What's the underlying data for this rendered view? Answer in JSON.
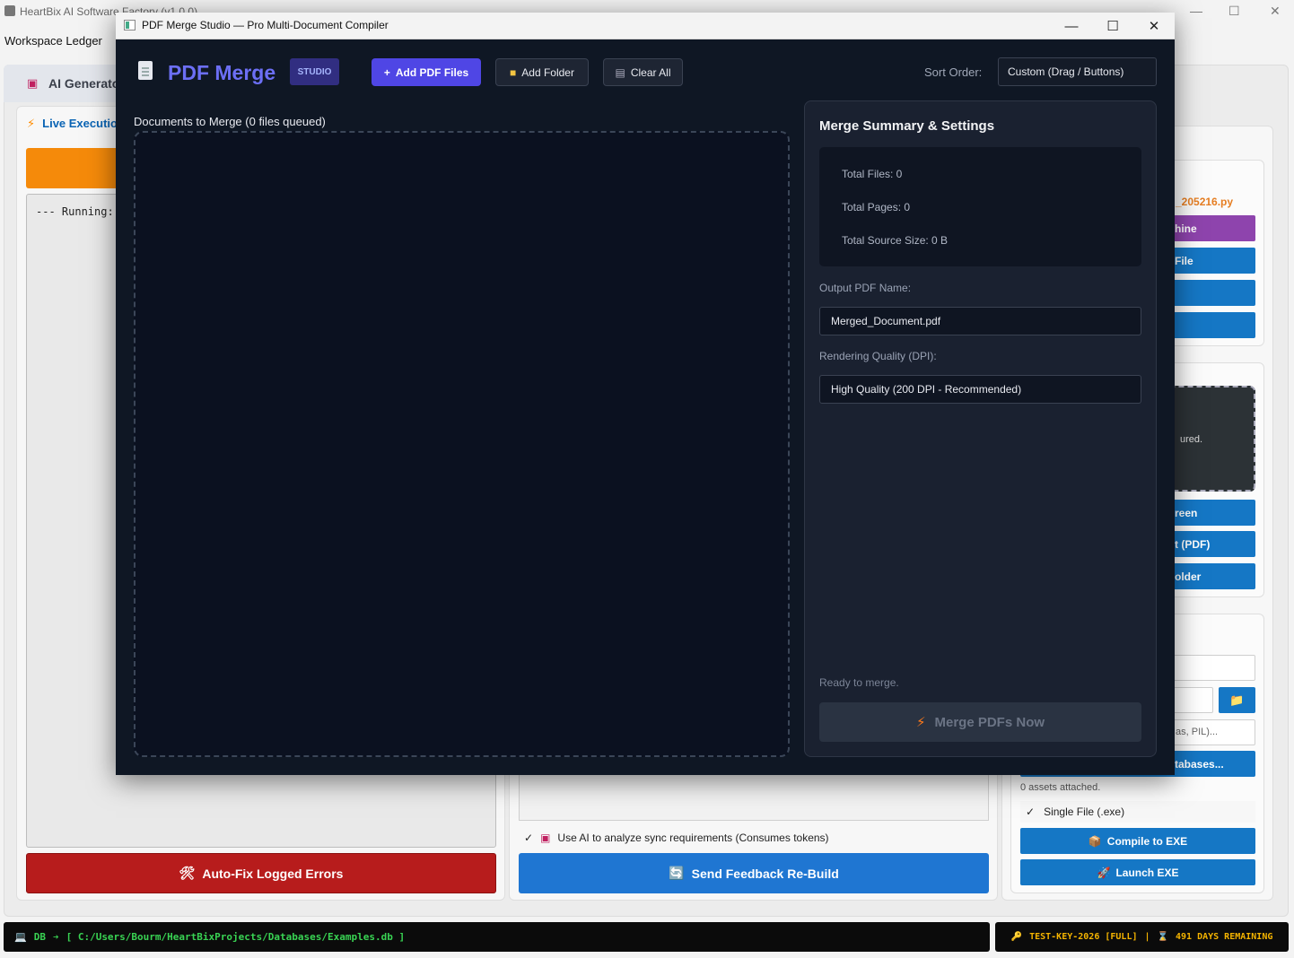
{
  "bg_app": {
    "title": "HeartBix AI Software Factory (v1.0.0)",
    "menu": "Workspace Ledger",
    "tab_label": "AI Generato",
    "live_label": "Live Execution",
    "console_text": "--- Running:",
    "autofix_label": "Auto-Fix Logged Errors",
    "use_ai_label": "Use AI to analyze  sync requirements (Consumes tokens)",
    "send_feedback_label": "Send Feedback  Re-Build",
    "right_file": "_205216.py",
    "right_buttons": [
      "hine",
      "File",
      "",
      ""
    ],
    "drop_hint": "ured.",
    "right_buttons2": [
      "reen",
      "t (PDF)",
      "older"
    ],
    "pkg_hint": "as, PIL)...",
    "db_button": "tabases...",
    "assets_text": "0 assets attached.",
    "single_file": "Single File (.exe)",
    "compile_label": "Compile to EXE",
    "launch_label": "Launch EXE",
    "db_prefix": "DB",
    "db_path": "[ C:/Users/Bourm/HeartBixProjects/Databases/Examples.db ]",
    "license_key": "TEST-KEY-2026 [FULL]",
    "license_sep": "|",
    "days_remaining": "491 DAYS REMAINING"
  },
  "modal": {
    "window_title": "PDF Merge Studio — Pro Multi-Document Compiler",
    "logo_text": "PDF Merge",
    "badge": "STUDIO",
    "toolbar": {
      "add_files": "Add PDF Files",
      "add_folder": "Add Folder",
      "clear_all": "Clear All"
    },
    "sort_label": "Sort Order:",
    "sort_value": "Custom (Drag / Buttons)",
    "docs_label": "Documents to Merge (0 files queued)",
    "summary": {
      "title": "Merge Summary & Settings",
      "total_files": "Total Files: 0",
      "total_pages": "Total Pages: 0",
      "total_size": "Total Source Size: 0 B",
      "output_label": "Output PDF Name:",
      "output_value": "Merged_Document.pdf",
      "quality_label": "Rendering Quality (DPI):",
      "quality_value": "High Quality (200 DPI - Recommended)",
      "status": "Ready to merge.",
      "merge_button": "Merge PDFs Now"
    }
  },
  "colors": {
    "accent": "#4f46e5",
    "logo": "#6c6ff5",
    "modal_bg": "#0f1724",
    "panel_bg": "#1a2130",
    "danger": "#b71c1c",
    "primary_blue": "#1f76d2",
    "terminal_green": "#39d353",
    "license_gold": "#f5b400"
  },
  "icons": {
    "window": "window-icon",
    "document": "document-icon",
    "plus": "plus-icon",
    "folder": "folder-icon",
    "trash": "trash-icon",
    "bolt": "bolt-icon",
    "tools": "tools-icon",
    "refresh": "refresh-icon",
    "key": "key-icon",
    "hourglass": "hourglass-icon",
    "computer": "computer-icon"
  }
}
